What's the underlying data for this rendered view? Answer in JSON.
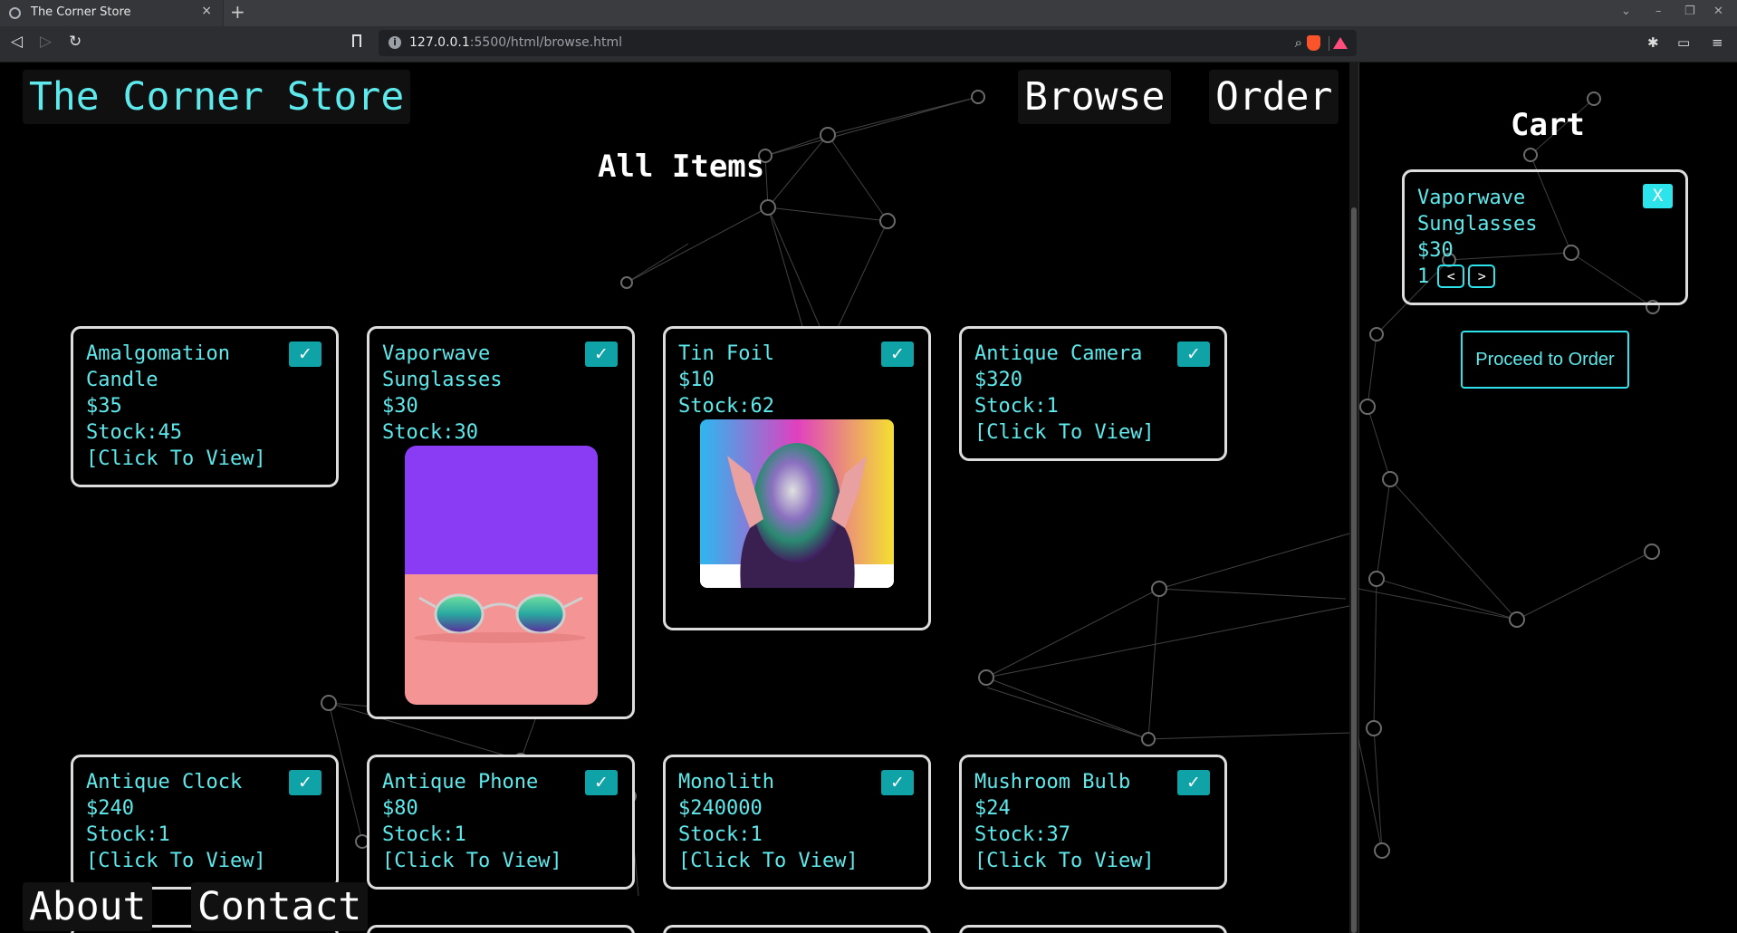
{
  "browser": {
    "tab_title": "The Corner Store",
    "tab_close": "×",
    "new_tab": "+",
    "url_host": "127.0.0.1",
    "url_rest": ":5500/html/browse.html",
    "window_controls": [
      "⌄",
      "–",
      "❐",
      "✕"
    ]
  },
  "site": {
    "brand": "The Corner Store",
    "nav": [
      "Browse",
      "Order"
    ],
    "heading": "All Items",
    "footer": [
      "About",
      "Contact"
    ]
  },
  "items": [
    {
      "name": "Amalgomation Candle",
      "price": "$35",
      "stock": "Stock:45",
      "view": "[Click To View]",
      "check": "✓"
    },
    {
      "name": "Vaporwave Sunglasses",
      "price": "$30",
      "stock": "Stock:30",
      "image": "sunglasses",
      "check": "✓"
    },
    {
      "name": "Tin Foil",
      "price": "$10",
      "stock": "Stock:62",
      "image": "foil-head",
      "check": "✓"
    },
    {
      "name": "Antique Camera",
      "price": "$320",
      "stock": "Stock:1",
      "view": "[Click To View]",
      "check": "✓"
    },
    {
      "name": "Antique Clock",
      "price": "$240",
      "stock": "Stock:1",
      "view": "[Click To View]",
      "check": "✓"
    },
    {
      "name": "Antique Phone",
      "price": "$80",
      "stock": "Stock:1",
      "view": "[Click To View]",
      "check": "✓"
    },
    {
      "name": "Monolith",
      "price": "$240000",
      "stock": "Stock:1",
      "view": "[Click To View]",
      "check": "✓"
    },
    {
      "name": "Mushroom Bulb",
      "price": "$24",
      "stock": "Stock:37",
      "view": "[Click To View]",
      "check": "✓"
    }
  ],
  "cart": {
    "title": "Cart",
    "items": [
      {
        "name": "Vaporwave Sunglasses",
        "price": "$30",
        "quantity": "1",
        "remove": "X",
        "decrease": "<",
        "increase": ">"
      }
    ],
    "proceed": "Proceed to Order"
  },
  "colors": {
    "accent": "#5ee9ec",
    "button": "#0fa3a7",
    "background": "#000000"
  }
}
